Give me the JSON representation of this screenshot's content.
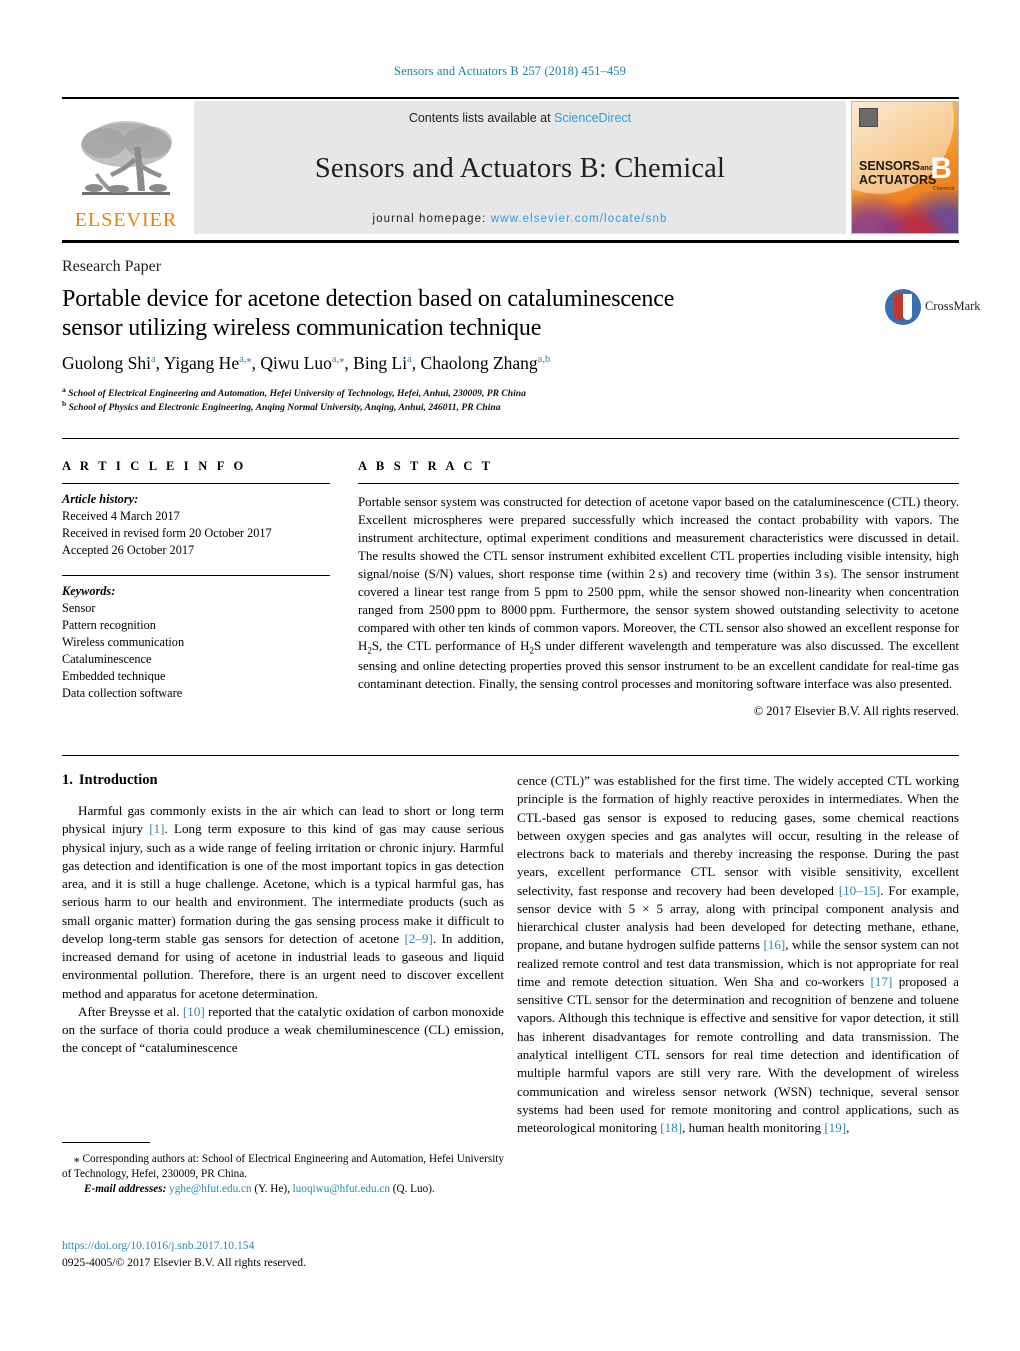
{
  "running_head": "Sensors and Actuators B 257 (2018) 451–459",
  "masthead": {
    "contents_prefix": "Contents lists available at ",
    "contents_link": "ScienceDirect",
    "journal_title": "Sensors and Actuators B: Chemical",
    "homepage_prefix": "journal homepage: ",
    "homepage_link": "www.elsevier.com/locate/snb",
    "publisher_wordmark": "ELSEVIER",
    "cover": {
      "line1": "SENSORS",
      "line1_small": "and",
      "line2": "ACTUATORS",
      "letter": "B",
      "letter_sub": "Chemical"
    }
  },
  "article": {
    "type": "Research Paper",
    "title_line1": "Portable device for acetone detection based on cataluminescence",
    "title_line2": "sensor utilizing wireless communication technique",
    "crossmark_label": "CrossMark",
    "authors_html": "Guolong Shi<sup>a</sup>, Yigang He<sup>a,⁎</sup>, Qiwu Luo<sup>a,⁎</sup>, Bing Li<sup>a</sup>, Chaolong Zhang<sup>a,b</sup>",
    "affiliation_a": "School of Electrical Engineering and Automation, Hefei University of Technology, Hefei, Anhui, 230009, PR China",
    "affiliation_b": "School of Physics and Electronic Engineering, Anqing Normal University, Anqing, Anhui, 246011, PR China"
  },
  "article_info": {
    "heading": "A R T I C L E  I N F O",
    "history_label": "Article history:",
    "history": [
      "Received 4 March 2017",
      "Received in revised form 20 October 2017",
      "Accepted 26 October 2017"
    ],
    "keywords_label": "Keywords:",
    "keywords": [
      "Sensor",
      "Pattern recognition",
      "Wireless communication",
      "Cataluminescence",
      "Embedded technique",
      "Data collection software"
    ]
  },
  "abstract": {
    "heading": "A B S T R A C T",
    "text": "Portable sensor system was constructed for detection of acetone vapor based on the cataluminescence (CTL) theory. Excellent microspheres were prepared successfully which increased the contact probability with vapors. The instrument architecture, optimal experiment conditions and measurement characteristics were discussed in detail. The results showed the CTL sensor instrument exhibited excellent CTL properties including visible intensity, high signal/noise (S/N) values, short response time (within 2 s) and recovery time (within 3 s). The sensor instrument covered a linear test range from 5 ppm to 2500 ppm, while the sensor showed non-linearity when concentration ranged from 2500 ppm to 8000 ppm. Furthermore, the sensor system showed outstanding selectivity to acetone compared with other ten kinds of common vapors. Moreover, the CTL sensor also showed an excellent response for H2S, the CTL performance of H2S under different wavelength and temperature was also discussed. The excellent sensing and online detecting properties proved this sensor instrument to be an excellent candidate for real-time gas contaminant detection. Finally, the sensing control processes and monitoring software interface was also presented.",
    "copyright": "© 2017 Elsevier B.V. All rights reserved."
  },
  "introduction": {
    "number": "1.",
    "heading": "Introduction",
    "left_paragraph_1": "Harmful gas commonly exists in the air which can lead to short or long term physical injury [1]. Long term exposure to this kind of gas may cause serious physical injury, such as a wide range of feeling irritation or chronic injury. Harmful gas detection and identification is one of the most important topics in gas detection area, and it is still a huge challenge. Acetone, which is a typical harmful gas, has serious harm to our health and environment. The intermediate products (such as small organic matter) formation during the gas sensing process make it difficult to develop long-term stable gas sensors for detection of acetone [2–9]. In addition, increased demand for using of acetone in industrial leads to gaseous and liquid environmental pollution. Therefore, there is an urgent need to discover excellent method and apparatus for acetone determination.",
    "left_paragraph_2": "After Breysse et al. [10] reported that the catalytic oxidation of carbon monoxide on the surface of thoria could produce a weak chemiluminescence (CL) emission, the concept of “cataluminescence",
    "right_paragraph_1": "cence (CTL)” was established for the first time. The widely accepted CTL working principle is the formation of highly reactive peroxides in intermediates. When the CTL-based gas sensor is exposed to reducing gases, some chemical reactions between oxygen species and gas analytes will occur, resulting in the release of electrons back to materials and thereby increasing the response. During the past years, excellent performance CTL sensor with visible sensitivity, excellent selectivity, fast response and recovery had been developed [10–15]. For example, sensor device with 5 × 5 array, along with principal component analysis and hierarchical cluster analysis had been developed for detecting methane, ethane, propane, and butane hydrogen sulfide patterns [16], while the sensor system can not realized remote control and test data transmission, which is not appropriate for real time and remote detection situation. Wen Sha and co-workers [17] proposed a sensitive CTL sensor for the determination and recognition of benzene and toluene vapors. Although this technique is effective and sensitive for vapor detection, it still has inherent disadvantages for remote controlling and data transmission. The analytical intelligent CTL sensors for real time detection and identification of multiple harmful vapors are still very rare. With the development of wireless communication and wireless sensor network (WSN) technique, several sensor systems had been used for remote monitoring and control applications, such as meteorological monitoring [18], human health monitoring [19],"
  },
  "footnote": {
    "corresponding_marker": "⁎",
    "corresponding_text": "Corresponding authors at: School of Electrical Engineering and Automation, Hefei University of Technology, Hefei, 230009, PR China.",
    "email_label": "E-mail addresses:",
    "email_1": "yghe@hfut.edu.cn",
    "email_1_owner": "(Y. He),",
    "email_2": "luoqiwu@hfut.edu.cn",
    "email_2_owner": "(Q. Luo).",
    "doi": "https://doi.org/10.1016/j.snb.2017.10.154",
    "issn_line": "0925-4005/© 2017 Elsevier B.V. All rights reserved."
  },
  "colors": {
    "link": "#2b86b2",
    "running_head": "#1b7fa8",
    "elsevier_orange": "#f07f09",
    "band_gray": "#e6e7e8",
    "science_direct": "#2ca0d8"
  }
}
